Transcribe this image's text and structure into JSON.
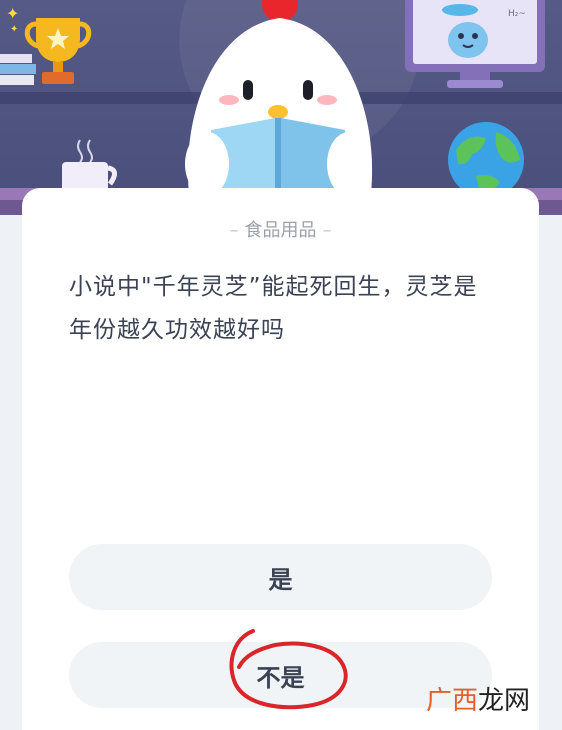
{
  "quiz": {
    "category": "食品用品",
    "question": "小说中\"千年灵芝”能起死回生，灵芝是年份越久功效越好吗",
    "options": [
      {
        "label": "是"
      },
      {
        "label": "不是"
      }
    ]
  },
  "watermark": {
    "part_a": "广西",
    "part_b": "龙网"
  },
  "icons": {
    "monitor_text": "H₂~"
  },
  "colors": {
    "hero_bg": "#565a86",
    "card_bg": "#ffffff",
    "option_bg": "#f1f4f6",
    "text_main": "#3a4254",
    "text_muted": "#9aa1ad",
    "marker_red": "#d9262a"
  }
}
